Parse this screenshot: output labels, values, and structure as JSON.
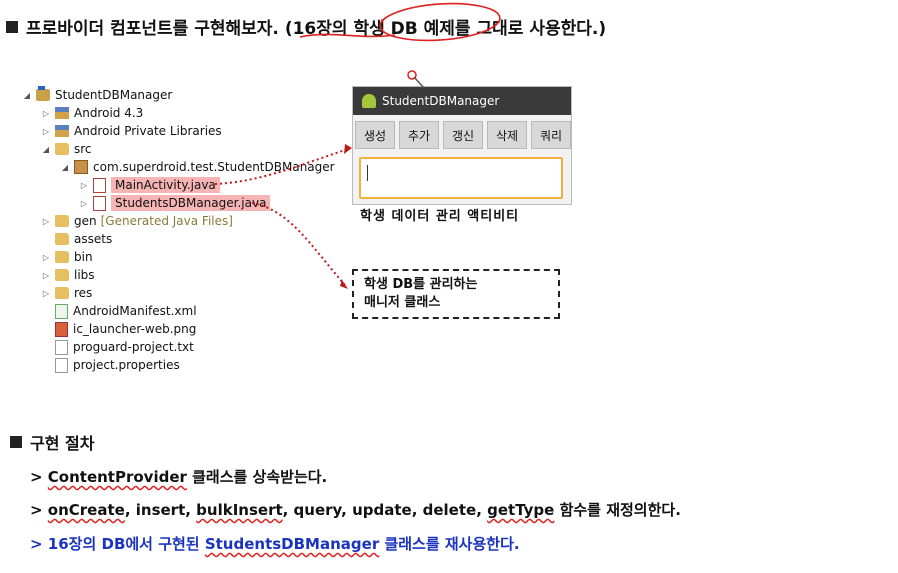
{
  "header": {
    "title_pre": "프로바이더 컴포넌트를 구현해보자. (16장의 ",
    "title_mid": "학생 DB 예제를",
    "title_post": " 그대로 사용한다.)"
  },
  "tree": {
    "rows": [
      {
        "label": "StudentDBManager",
        "icon": "project-icon",
        "arrow": "◢",
        "indent": 0
      },
      {
        "label": "Android 4.3",
        "icon": "library-icon",
        "arrow": "▷",
        "indent": 1
      },
      {
        "label": "Android Private Libraries",
        "icon": "library-icon",
        "arrow": "▷",
        "indent": 1
      },
      {
        "label": "src",
        "icon": "source-folder-icon",
        "arrow": "◢",
        "indent": 1
      },
      {
        "label": "com.superdroid.test.StudentDBManager",
        "icon": "package-icon",
        "arrow": "◢",
        "indent": 2
      },
      {
        "label": "MainActivity.java",
        "icon": "java-file-icon",
        "arrow": "▷",
        "indent": 3,
        "highlight": true
      },
      {
        "label": "StudentsDBManager.java",
        "icon": "java-file-icon",
        "arrow": "▷",
        "indent": 3,
        "highlight": true
      },
      {
        "label": "gen",
        "icon": "folder-icon",
        "arrow": "▷",
        "indent": 1,
        "note": "[Generated Java Files]"
      },
      {
        "label": "assets",
        "icon": "folder-icon",
        "arrow": "",
        "indent": 1
      },
      {
        "label": "bin",
        "icon": "folder-icon",
        "arrow": "▷",
        "indent": 1
      },
      {
        "label": "libs",
        "icon": "folder-icon",
        "arrow": "▷",
        "indent": 1
      },
      {
        "label": "res",
        "icon": "folder-icon",
        "arrow": "▷",
        "indent": 1
      },
      {
        "label": "AndroidManifest.xml",
        "icon": "xml-file-icon",
        "arrow": "",
        "indent": 1
      },
      {
        "label": "ic_launcher-web.png",
        "icon": "png-file-icon",
        "arrow": "",
        "indent": 1
      },
      {
        "label": "proguard-project.txt",
        "icon": "text-file-icon",
        "arrow": "",
        "indent": 1
      },
      {
        "label": "project.properties",
        "icon": "text-file-icon",
        "arrow": "",
        "indent": 1
      }
    ]
  },
  "phone": {
    "title": "StudentDBManager",
    "buttons": [
      "생성",
      "추가",
      "갱신",
      "삭제",
      "쿼리"
    ],
    "caption": "학생 데이터 관리 액티비티"
  },
  "callout": {
    "line1": "학생 DB를 관리하는",
    "line2": "매니저 클래스"
  },
  "section": {
    "title": "구현 절차",
    "step1_prefix": "> ",
    "step1_class": "ContentProvider",
    "step1_rest": " 클래스를 상속받는다.",
    "step2_prefix": "> ",
    "step2_m1": "onCreate",
    "step2_mid": ", insert, ",
    "step2_m2": "bulkInsert",
    "step2_mid2": ", query, update, delete, ",
    "step2_m3": "getType",
    "step2_rest": " 함수를 재정의한다.",
    "step3_prefix": "> 16장의 DB에서 구현된 ",
    "step3_class": "StudentsDBManager",
    "step3_rest": " 클래스를 재사용한다."
  },
  "colors": {
    "highlight": "#f6b4b4",
    "annotation": "#d22222",
    "blue_text": "#1a33c0"
  }
}
